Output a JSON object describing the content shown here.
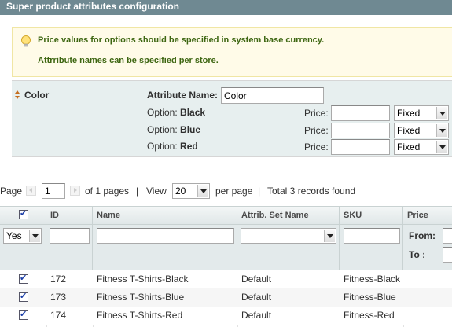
{
  "section": {
    "title": "Super product attributes configuration"
  },
  "notice": {
    "line1": "Price values for options should be specified in system base currency.",
    "line2": "Attrribute names can be specified per store."
  },
  "attribute": {
    "name": "Color",
    "name_label": "Attribute Name:",
    "name_value": "Color",
    "price_label": "Price:",
    "options": [
      {
        "label": "Option:",
        "value": "Black",
        "price": "",
        "type": "Fixed"
      },
      {
        "label": "Option:",
        "value": "Blue",
        "price": "",
        "type": "Fixed"
      },
      {
        "label": "Option:",
        "value": "Red",
        "price": "",
        "type": "Fixed"
      }
    ]
  },
  "pager": {
    "page_label": "Page",
    "page_value": "1",
    "of_pages": "of 1 pages",
    "sep1": "|",
    "view_label": "View",
    "per_page_value": "20",
    "per_page_label": "per page",
    "sep2": "|",
    "total": "Total 3 records found"
  },
  "grid": {
    "columns": {
      "id": "ID",
      "name": "Name",
      "set": "Attrib. Set Name",
      "sku": "SKU",
      "price": "Price"
    },
    "filters": {
      "in_products": "Yes",
      "price_from": "From:",
      "price_to": "To :"
    },
    "rows": [
      {
        "id": "172",
        "name": "Fitness T-Shirts-Black",
        "set": "Default",
        "sku": "Fitness-Black"
      },
      {
        "id": "173",
        "name": "Fitness T-Shirts-Blue",
        "set": "Default",
        "sku": "Fitness-Blue"
      },
      {
        "id": "174",
        "name": "Fitness T-Shirts-Red",
        "set": "Default",
        "sku": "Fitness-Red"
      }
    ]
  },
  "colors": {
    "header_bg": "#6f8992",
    "notice_text": "#3d6611",
    "panel_bg": "#e7efef",
    "check": "#1a3da8"
  }
}
